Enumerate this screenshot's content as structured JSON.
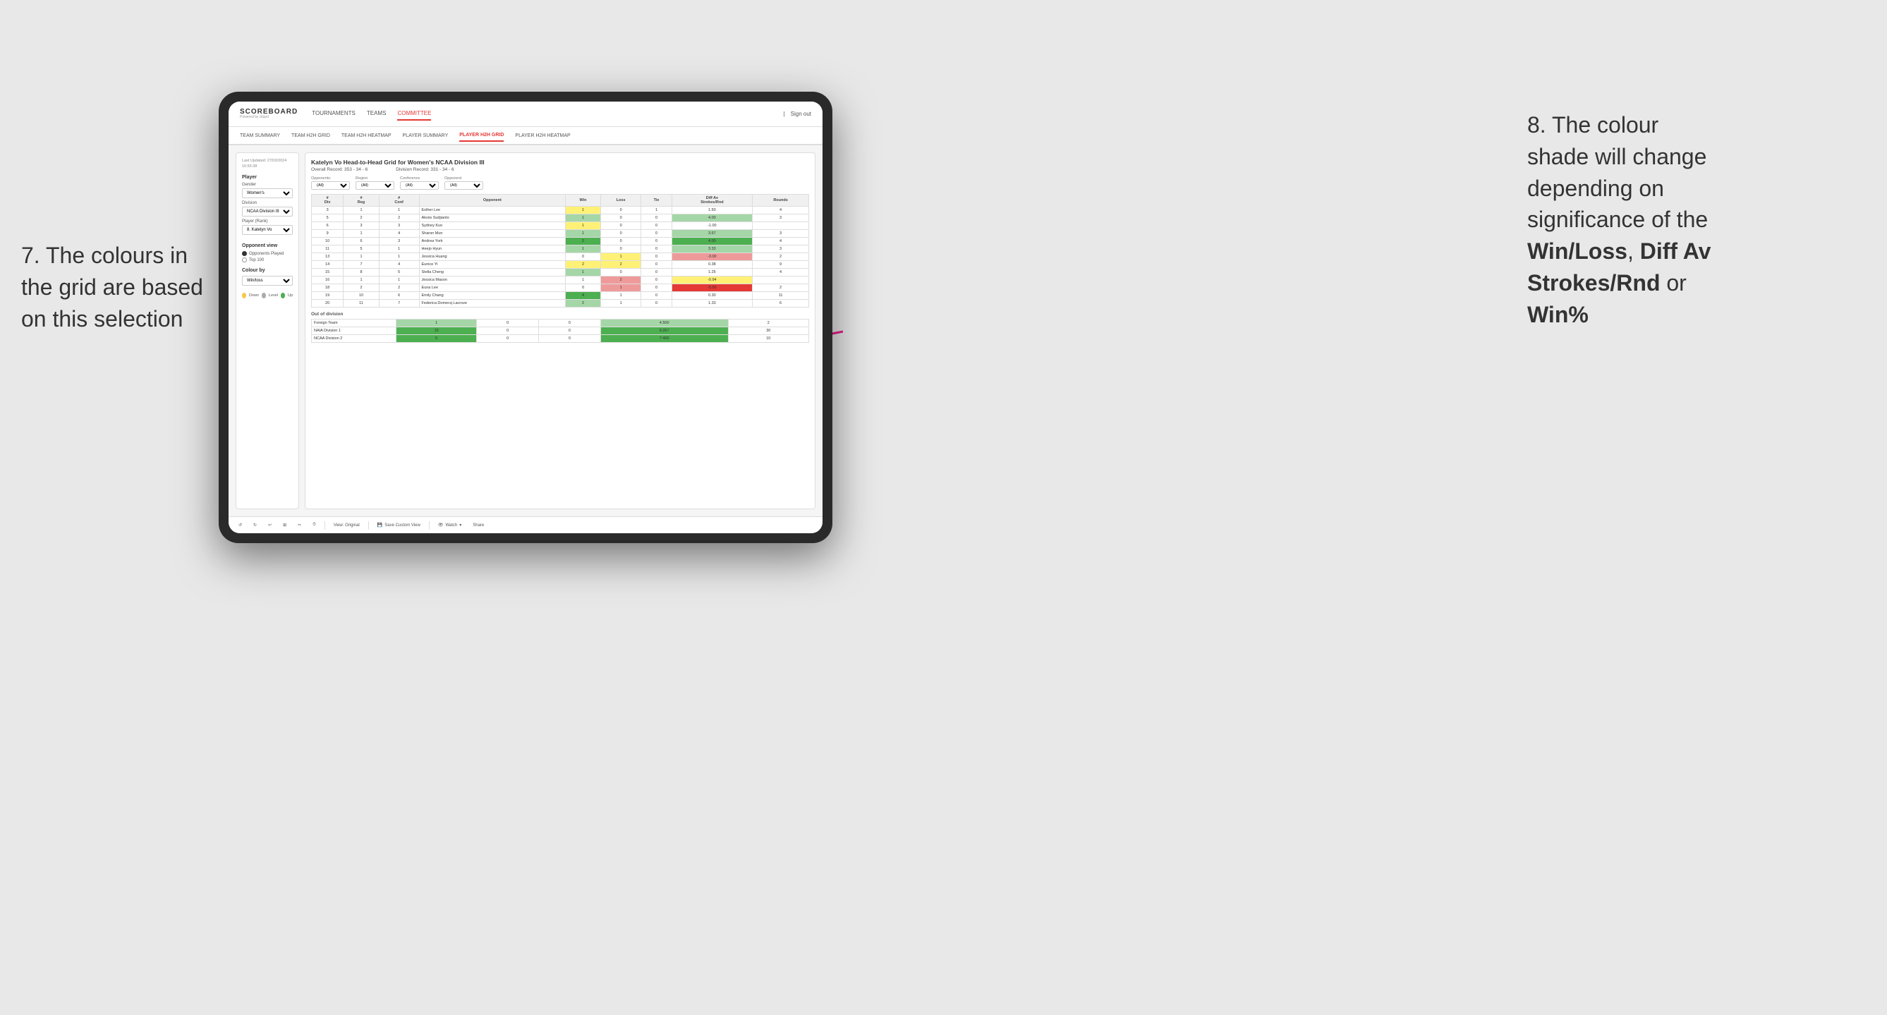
{
  "annotations": {
    "left": {
      "line1": "7. The colours in",
      "line2": "the grid are based",
      "line3": "on this selection"
    },
    "right": {
      "line1": "8. The colour",
      "line2": "shade will change",
      "line3": "depending on",
      "line4": "significance of the",
      "bold1": "Win/Loss",
      "comma": ", ",
      "bold2": "Diff Av",
      "line5": "Strokes/Rnd",
      "line6": "or",
      "bold3": "Win%"
    }
  },
  "nav": {
    "logo": "SCOREBOARD",
    "logo_sub": "Powered by clippd",
    "items": [
      "TOURNAMENTS",
      "TEAMS",
      "COMMITTEE"
    ],
    "active": "COMMITTEE",
    "sign_in": "Sign out"
  },
  "sub_nav": {
    "items": [
      "TEAM SUMMARY",
      "TEAM H2H GRID",
      "TEAM H2H HEATMAP",
      "PLAYER SUMMARY",
      "PLAYER H2H GRID",
      "PLAYER H2H HEATMAP"
    ],
    "active": "PLAYER H2H GRID"
  },
  "left_panel": {
    "timestamp": "Last Updated: 27/03/2024\n16:55:38",
    "player_section": "Player",
    "gender_label": "Gender",
    "gender_value": "Women's",
    "division_label": "Division",
    "division_value": "NCAA Division III",
    "player_rank_label": "Player (Rank)",
    "player_rank_value": "8. Katelyn Vo",
    "opponent_view_label": "Opponent view",
    "opponent_played": "Opponents Played",
    "top_100": "Top 100",
    "colour_by_label": "Colour by",
    "colour_by_value": "Win/loss",
    "legend": {
      "down_color": "#f9c74f",
      "level_color": "#aaaaaa",
      "up_color": "#4caf50",
      "down_label": "Down",
      "level_label": "Level",
      "up_label": "Up"
    }
  },
  "grid": {
    "title": "Katelyn Vo Head-to-Head Grid for Women's NCAA Division III",
    "overall_record_label": "Overall Record:",
    "overall_record_value": "353 - 34 - 6",
    "division_record_label": "Division Record:",
    "division_record_value": "331 - 34 - 6",
    "filters": {
      "opponents_label": "Opponents:",
      "opponents_value": "(All)",
      "region_label": "Region",
      "region_value": "(All)",
      "conference_label": "Conference",
      "conference_value": "(All)",
      "opponent_label": "Opponent",
      "opponent_value": "(All)"
    },
    "columns": [
      "#\nDiv",
      "#\nReg",
      "#\nConf",
      "Opponent",
      "Win",
      "Loss",
      "Tie",
      "Diff Av\nStrokes/Rnd",
      "Rounds"
    ],
    "rows": [
      {
        "div": "3",
        "reg": "1",
        "conf": "1",
        "opponent": "Esther Lee",
        "win": "1",
        "loss": "0",
        "tie": "1",
        "diff": "1.50",
        "rounds": "4",
        "win_color": "cell-yellow",
        "diff_color": ""
      },
      {
        "div": "5",
        "reg": "2",
        "conf": "2",
        "opponent": "Alexis Sudjianto",
        "win": "1",
        "loss": "0",
        "tie": "0",
        "diff": "4.00",
        "rounds": "3",
        "win_color": "cell-green-light",
        "diff_color": "cell-green-light"
      },
      {
        "div": "6",
        "reg": "3",
        "conf": "3",
        "opponent": "Sydney Kuo",
        "win": "1",
        "loss": "0",
        "tie": "0",
        "diff": "-1.00",
        "rounds": "",
        "win_color": "cell-yellow",
        "diff_color": ""
      },
      {
        "div": "9",
        "reg": "1",
        "conf": "4",
        "opponent": "Sharon Mun",
        "win": "1",
        "loss": "0",
        "tie": "0",
        "diff": "3.67",
        "rounds": "3",
        "win_color": "cell-green-light",
        "diff_color": "cell-green-light"
      },
      {
        "div": "10",
        "reg": "6",
        "conf": "3",
        "opponent": "Andrea York",
        "win": "2",
        "loss": "0",
        "tie": "0",
        "diff": "4.00",
        "rounds": "4",
        "win_color": "cell-green-dark",
        "diff_color": "cell-green-dark"
      },
      {
        "div": "11",
        "reg": "5",
        "conf": "1",
        "opponent": "Heejo Hyun",
        "win": "1",
        "loss": "0",
        "tie": "0",
        "diff": "3.33",
        "rounds": "3",
        "win_color": "cell-green-light",
        "diff_color": "cell-green-light"
      },
      {
        "div": "13",
        "reg": "1",
        "conf": "1",
        "opponent": "Jessica Huang",
        "win": "0",
        "loss": "1",
        "tie": "0",
        "diff": "-3.00",
        "rounds": "2",
        "win_color": "cell-yellow",
        "diff_color": "cell-red-light"
      },
      {
        "div": "14",
        "reg": "7",
        "conf": "4",
        "opponent": "Eunice Yi",
        "win": "2",
        "loss": "2",
        "tie": "0",
        "diff": "0.38",
        "rounds": "9",
        "win_color": "cell-yellow",
        "diff_color": ""
      },
      {
        "div": "15",
        "reg": "8",
        "conf": "5",
        "opponent": "Stella Cheng",
        "win": "1",
        "loss": "0",
        "tie": "0",
        "diff": "1.25",
        "rounds": "4",
        "win_color": "cell-green-light",
        "diff_color": ""
      },
      {
        "div": "16",
        "reg": "1",
        "conf": "1",
        "opponent": "Jessica Mason",
        "win": "1",
        "loss": "2",
        "tie": "0",
        "diff": "-0.94",
        "rounds": "",
        "win_color": "cell-red-light",
        "diff_color": "cell-yellow"
      },
      {
        "div": "18",
        "reg": "2",
        "conf": "2",
        "opponent": "Euna Lee",
        "win": "0",
        "loss": "1",
        "tie": "0",
        "diff": "-5.00",
        "rounds": "2",
        "win_color": "cell-red-light",
        "diff_color": "cell-red-dark"
      },
      {
        "div": "19",
        "reg": "10",
        "conf": "6",
        "opponent": "Emily Chang",
        "win": "4",
        "loss": "1",
        "tie": "0",
        "diff": "0.30",
        "rounds": "11",
        "win_color": "cell-green-dark",
        "diff_color": ""
      },
      {
        "div": "20",
        "reg": "11",
        "conf": "7",
        "opponent": "Federica Domecq Lacroze",
        "win": "2",
        "loss": "1",
        "tie": "0",
        "diff": "1.33",
        "rounds": "6",
        "win_color": "cell-green-light",
        "diff_color": ""
      }
    ],
    "out_of_division_title": "Out of division",
    "out_of_division_rows": [
      {
        "label": "Foreign Team",
        "win": "1",
        "loss": "0",
        "tie": "0",
        "diff": "4.500",
        "rounds": "2",
        "win_color": "cell-green-light",
        "diff_color": "cell-green-light"
      },
      {
        "label": "NAIA Division 1",
        "win": "15",
        "loss": "0",
        "tie": "0",
        "diff": "9.267",
        "rounds": "30",
        "win_color": "cell-green-dark",
        "diff_color": "cell-green-dark"
      },
      {
        "label": "NCAA Division 2",
        "win": "5",
        "loss": "0",
        "tie": "0",
        "diff": "7.400",
        "rounds": "10",
        "win_color": "cell-green-dark",
        "diff_color": "cell-green-dark"
      }
    ]
  },
  "toolbar": {
    "view_original": "View: Original",
    "save_custom": "Save Custom View",
    "watch": "Watch",
    "share": "Share"
  }
}
